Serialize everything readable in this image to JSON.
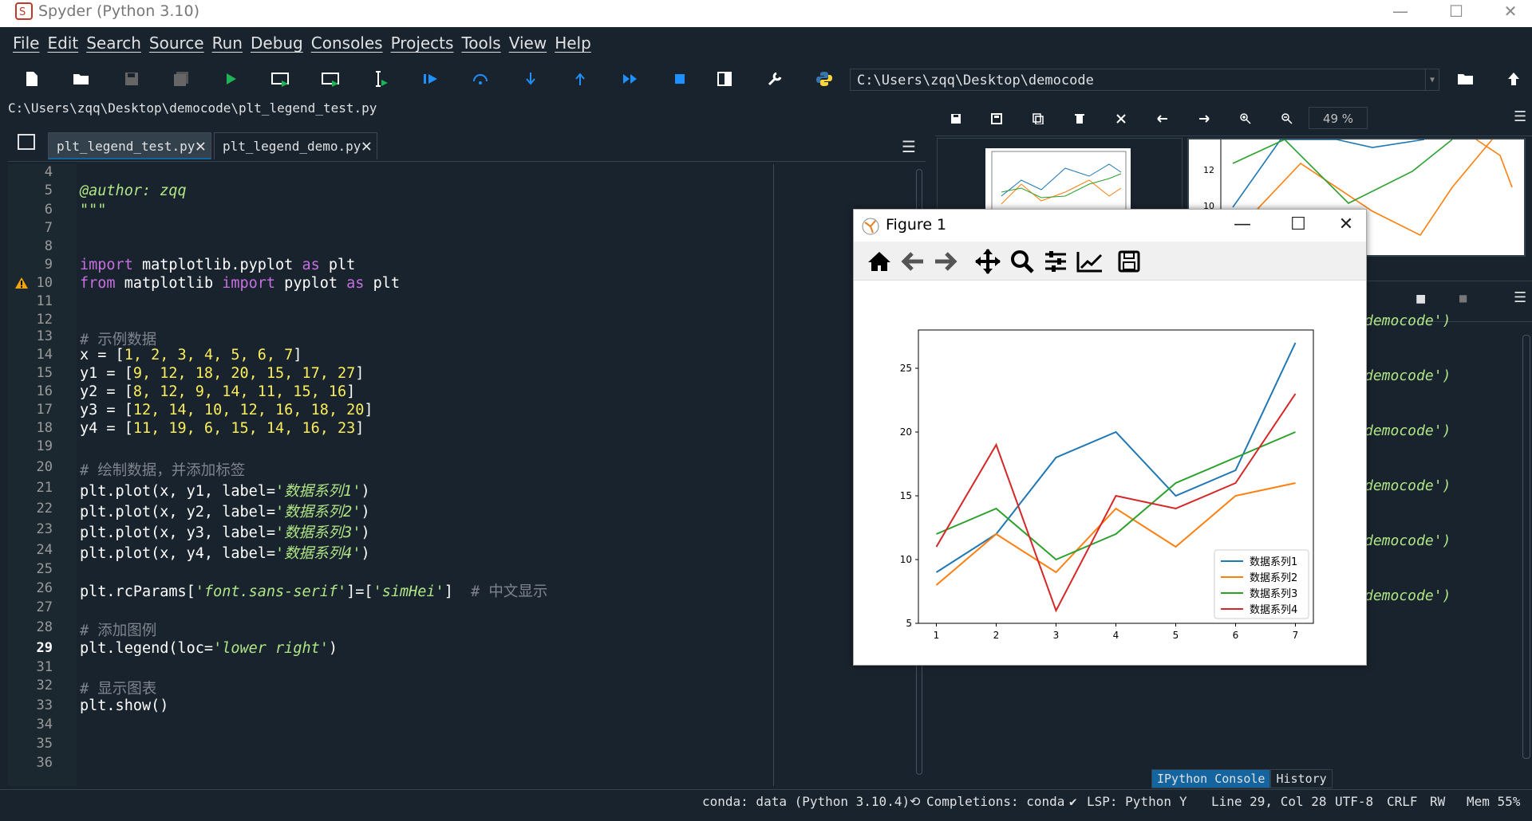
{
  "window": {
    "title": "Spyder (Python 3.10)",
    "minimize": "—",
    "maximize": "☐",
    "close": "✕"
  },
  "menu": [
    "File",
    "Edit",
    "Search",
    "Source",
    "Run",
    "Debug",
    "Consoles",
    "Projects",
    "Tools",
    "View",
    "Help"
  ],
  "toolbar": {
    "working_dir": "C:\\Users\\zqq\\Desktop\\democode"
  },
  "editor": {
    "path": "C:\\Users\\zqq\\Desktop\\democode\\plt_legend_test.py",
    "tabs": [
      {
        "label": "plt_legend_test.py",
        "close": "✕",
        "active": true
      },
      {
        "label": "plt_legend_demo.py",
        "close": "✕",
        "active": false
      }
    ],
    "current_line": "29",
    "line_numbers": [
      "4",
      "5",
      "6",
      "7",
      "8",
      "9",
      "10",
      "11",
      "12",
      "13",
      "14",
      "15",
      "16",
      "17",
      "18",
      "19",
      "20",
      "21",
      "22",
      "23",
      "24",
      "25",
      "26",
      "27",
      "28",
      "29",
      "31",
      "32",
      "33",
      "34",
      "35",
      "36"
    ],
    "code": {
      "l5": "@author: zqq",
      "l6": "\"\"\"",
      "l9_kw1": "import",
      "l9_mod": " matplotlib.pyplot ",
      "l9_kw2": "as",
      "l9_name": " plt",
      "l10_kw1": "from",
      "l10_mod": " matplotlib ",
      "l10_kw2": "import",
      "l10_mid": " pyplot ",
      "l10_kw3": "as",
      "l10_name": " plt",
      "l13": "# 示例数据",
      "l14_a": "x = [",
      "l14_n": "1, 2, 3, 4, 5, 6, 7",
      "l14_b": "]",
      "l15_a": "y1 = [",
      "l15_n": "9, 12, 18, 20, 15, 17, 27",
      "l15_b": "]",
      "l16_a": "y2 = [",
      "l16_n": "8, 12, 9, 14, 11, 15, 16",
      "l16_b": "]",
      "l17_a": "y3 = [",
      "l17_n": "12, 14, 10, 12, 16, 18, 20",
      "l17_b": "]",
      "l18_a": "y4 = [",
      "l18_n": "11, 19, 6, 15, 14, 16, 23",
      "l18_b": "]",
      "l20": "# 绘制数据，并添加标签",
      "l21_a": "plt.plot(x, y1, label=",
      "l21_s": "'数据系列1'",
      "l21_b": ")",
      "l22_a": "plt.plot(x, y2, label=",
      "l22_s": "'数据系列2'",
      "l22_b": ")",
      "l23_a": "plt.plot(x, y3, label=",
      "l23_s": "'数据系列3'",
      "l23_b": ")",
      "l24_a": "plt.plot(x, y4, label=",
      "l24_s": "'数据系列4'",
      "l24_b": ")",
      "l26_a": "plt.rcParams[",
      "l26_s1": "'font.sans-serif'",
      "l26_b": "]=[",
      "l26_s2": "'simHei'",
      "l26_c": "]  ",
      "l26_cm": "# 中文显示",
      "l28": "# 添加图例",
      "l29_a": "plt.legend(loc=",
      "l29_s": "'lower right'",
      "l29_b": ")",
      "l31": "# 显示图表",
      "l32": "plt.show()"
    }
  },
  "plots_pane": {
    "zoom": "49 %",
    "thumb_ticks": [
      "12",
      "10"
    ]
  },
  "console": {
    "lines": [
      "democode')",
      "democode')",
      "democode')",
      "democode')",
      "democode')",
      "democode')"
    ],
    "tabs": [
      "IPython Console",
      "History"
    ]
  },
  "status": {
    "conda": "conda: data (Python 3.10.4)",
    "completions": "Completions: conda",
    "lsp": "LSP: Python",
    "position": "Line 29, Col 28",
    "encoding": "UTF-8",
    "eol": "CRLF",
    "rw": "RW",
    "mem": "Mem 55%"
  },
  "figure": {
    "title": "Figure 1",
    "minimize": "—",
    "maximize": "☐",
    "close": "✕"
  },
  "chart_data": {
    "type": "line",
    "x": [
      1,
      2,
      3,
      4,
      5,
      6,
      7
    ],
    "series": [
      {
        "name": "数据系列1",
        "color": "#1f77b4",
        "values": [
          9,
          12,
          18,
          20,
          15,
          17,
          27
        ]
      },
      {
        "name": "数据系列2",
        "color": "#ff7f0e",
        "values": [
          8,
          12,
          9,
          14,
          11,
          15,
          16
        ]
      },
      {
        "name": "数据系列3",
        "color": "#2ca02c",
        "values": [
          12,
          14,
          10,
          12,
          16,
          18,
          20
        ]
      },
      {
        "name": "数据系列4",
        "color": "#d62728",
        "values": [
          11,
          19,
          6,
          15,
          14,
          16,
          23
        ]
      }
    ],
    "xticks": [
      "1",
      "2",
      "3",
      "4",
      "5",
      "6",
      "7"
    ],
    "yticks": [
      "5",
      "10",
      "15",
      "20",
      "25"
    ],
    "xlim": [
      0.7,
      7.3
    ],
    "ylim": [
      5,
      28
    ],
    "legend": "lower right",
    "grid": false
  }
}
